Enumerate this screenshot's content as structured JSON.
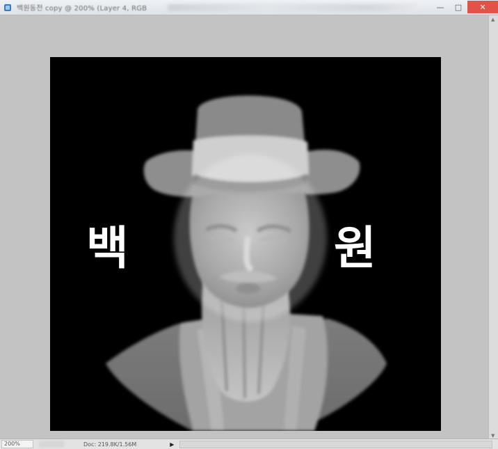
{
  "window": {
    "title": "백원동전 copy @ 200% (Layer 4, RGB",
    "minimize_label": "—",
    "maximize_label": "□",
    "close_label": "✕",
    "app_icon": "photoshop-document-icon"
  },
  "document": {
    "left_text": "백",
    "right_text": "원",
    "background_color": "#000000",
    "figure": "portrait of a man in a traditional hat"
  },
  "status_bar": {
    "zoom": "200%",
    "doc_info": "Doc: 219.8K/1.56M",
    "menu_arrow": "▶"
  }
}
